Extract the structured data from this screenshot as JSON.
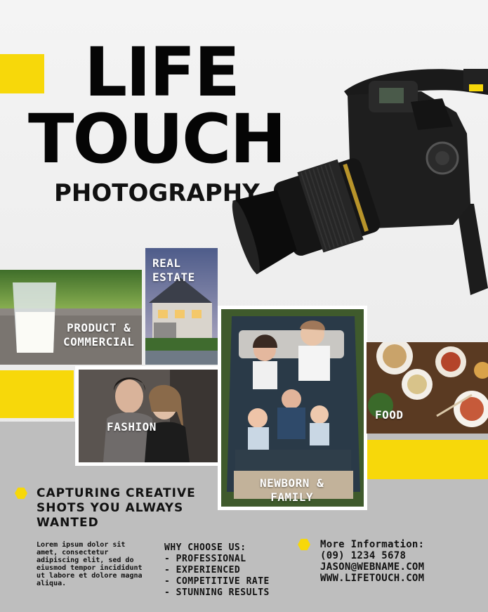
{
  "title": {
    "line1": "LIFE",
    "line2": "TOUCH",
    "subtitle": "PHOTOGRAPHY"
  },
  "categories": {
    "product": "PRODUCT & COMMERCIAL",
    "real_estate": "REAL ESTATE",
    "fashion": "FASHION",
    "family": "NEWBORN & FAMILY",
    "food": "FOOD"
  },
  "tagline": {
    "headline": "CAPTURING CREATIVE SHOTS YOU ALWAYS WANTED",
    "body": "Lorem ipsum dolor sit amet, consectetur adipiscing elit, sed do eiusmod tempor incididunt ut labore et dolore magna aliqua."
  },
  "why": {
    "heading": "WHY CHOOSE US:",
    "items": [
      "PROFESSIONAL",
      "EXPERIENCED",
      "COMPETITIVE RATE",
      "STUNNING RESULTS"
    ]
  },
  "contact": {
    "heading": "More Information:",
    "phone": "(09) 1234 5678",
    "email": "JASON@WEBNAME.COM",
    "website": "WWW.LIFETOUCH.COM"
  },
  "colors": {
    "accent": "#f7d80a",
    "band": "#bebebe",
    "text": "#111111"
  },
  "icons": [
    "hexagon-bullet-icon",
    "camera-image"
  ]
}
